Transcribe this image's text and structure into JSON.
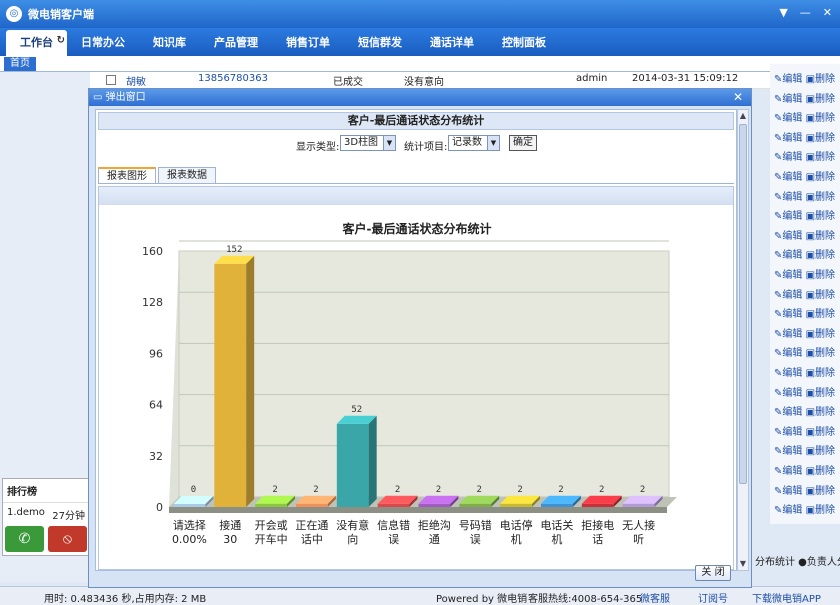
{
  "app": {
    "title": "微电销客户端"
  },
  "menu": {
    "items": [
      "工作台",
      "日常办公",
      "知识库",
      "产品管理",
      "销售订单",
      "短信群发",
      "通话详单",
      "控制面板"
    ],
    "home_tab": "首页"
  },
  "bg_table": {
    "row": {
      "name": "胡敏",
      "phone": "13856780363",
      "status": "已成交",
      "intent": "没有意向",
      "owner": "admin",
      "time": "2014-03-31 15:09:12"
    },
    "actions": {
      "edit": "编辑",
      "delete": "删除"
    }
  },
  "ranking": {
    "title": "排行榜",
    "item_name": "1.demo",
    "item_value": "27分钟"
  },
  "status": {
    "usage": "用时: 0.483436 秒,占用内存: 2 MB",
    "powered": "Powered by 微电销",
    "hotline": "客服热线:4008-654-365",
    "links": [
      "微客服",
      "订阅号",
      "下载微电销APP"
    ]
  },
  "bottom_tabs": "分布统计  ●负责人分布",
  "popup": {
    "title": "弹出窗口",
    "heading": "客户-最后通话状态分布统计",
    "display_type_label": "显示类型:",
    "display_type_value": "3D柱图",
    "stat_item_label": "统计项目:",
    "stat_item_value": "记录数",
    "ok": "确定",
    "tabs": [
      "报表图形",
      "报表数据"
    ],
    "close": "关 闭"
  },
  "chart_data": {
    "type": "bar",
    "title": "客户-最后通话状态分布统计",
    "ylim": [
      0,
      160
    ],
    "yticks": [
      0,
      32,
      64,
      96,
      128,
      160
    ],
    "categories": [
      "请选择0.00%",
      "接通30",
      "开会或开车中",
      "正在通话中",
      "没有意向",
      "信息错误",
      "拒绝沟通",
      "号码错误",
      "电话停机",
      "电话关机",
      "拒接电话",
      "无人接听"
    ],
    "category_labels_visible": [
      "请选择\n0.00%",
      "接通\n30",
      "开会或\n开车中",
      "正在通\n话中",
      "没有意\n向",
      "信息错\n误",
      "拒绝沟\n通",
      "号码错\n误",
      "电话停\n机",
      "电话关\n机",
      "拒接电\n话",
      "无人接\n听"
    ],
    "values": [
      0,
      152,
      2,
      2,
      52,
      2,
      2,
      2,
      2,
      2,
      2,
      2
    ],
    "colors": [
      "#a9cbe6",
      "#e0b23a",
      "#8cc63f",
      "#f0915c",
      "#3aa6a8",
      "#d9494c",
      "#a25bc2",
      "#7fae4a",
      "#c9b932",
      "#3d93d6",
      "#c8313a",
      "#b39ad6"
    ],
    "grid": true
  }
}
